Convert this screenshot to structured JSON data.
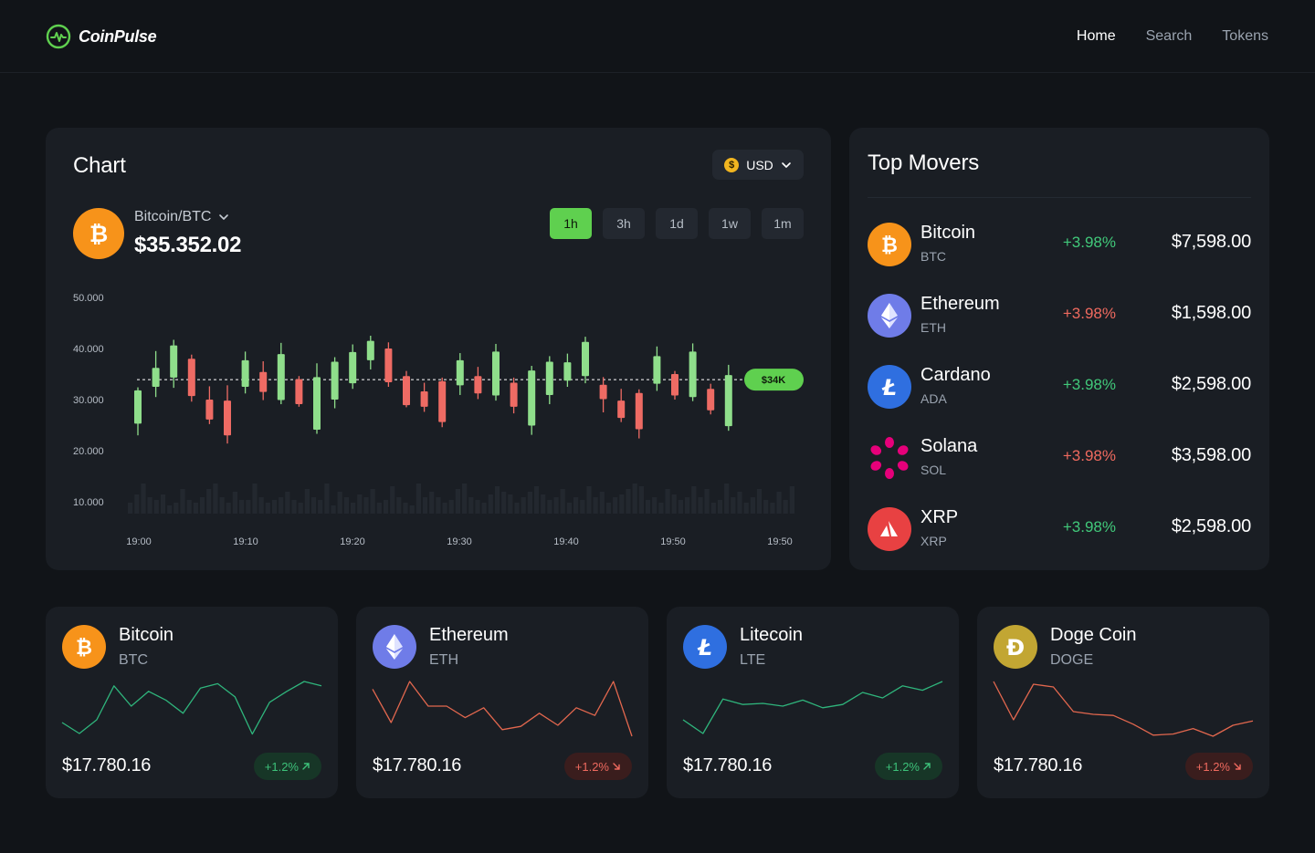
{
  "brand": {
    "name": "CoinPulse"
  },
  "nav": {
    "items": [
      "Home",
      "Search",
      "Tokens"
    ],
    "active": "Home"
  },
  "chart_card": {
    "title": "Chart",
    "currency": "USD",
    "pair": "Bitcoin/BTC",
    "price": "$35.352.02",
    "timeframes": [
      "1h",
      "3h",
      "1d",
      "1w",
      "1m"
    ],
    "active_timeframe": "1h"
  },
  "chart_data": {
    "type": "candlestick",
    "y_ticks": [
      "50.000",
      "40.000",
      "30.000",
      "20.000",
      "10.000"
    ],
    "x_ticks": [
      "19:00",
      "19:10",
      "19:20",
      "19:30",
      "19:40",
      "19:50",
      "19:50"
    ],
    "ylim": [
      10000,
      50000
    ],
    "current_price_label": "$34K",
    "current_price": 33900,
    "up_color": "#8fde8b",
    "down_color": "#ee6b64",
    "candles": [
      {
        "o": 25300,
        "c": 31800,
        "h": 32400,
        "l": 23000
      },
      {
        "o": 32500,
        "c": 36200,
        "h": 39500,
        "l": 30500
      },
      {
        "o": 34300,
        "c": 40600,
        "h": 41700,
        "l": 32300
      },
      {
        "o": 38000,
        "c": 30700,
        "h": 38800,
        "l": 29600
      },
      {
        "o": 30000,
        "c": 26100,
        "h": 32600,
        "l": 25200
      },
      {
        "o": 29800,
        "c": 23000,
        "h": 32800,
        "l": 21400
      },
      {
        "o": 32500,
        "c": 37700,
        "h": 39400,
        "l": 31200
      },
      {
        "o": 35400,
        "c": 31500,
        "h": 37500,
        "l": 29900
      },
      {
        "o": 29900,
        "c": 38900,
        "h": 41100,
        "l": 29100
      },
      {
        "o": 34000,
        "c": 29100,
        "h": 34600,
        "l": 28600
      },
      {
        "o": 24100,
        "c": 34400,
        "h": 37100,
        "l": 23300
      },
      {
        "o": 30000,
        "c": 37400,
        "h": 38300,
        "l": 28300
      },
      {
        "o": 33200,
        "c": 39300,
        "h": 40800,
        "l": 32100
      },
      {
        "o": 37700,
        "c": 41500,
        "h": 42500,
        "l": 35900
      },
      {
        "o": 40000,
        "c": 33400,
        "h": 41200,
        "l": 32500
      },
      {
        "o": 34600,
        "c": 28900,
        "h": 35600,
        "l": 28500
      },
      {
        "o": 31600,
        "c": 28600,
        "h": 33300,
        "l": 27600
      },
      {
        "o": 33600,
        "c": 25600,
        "h": 34300,
        "l": 24600
      },
      {
        "o": 32800,
        "c": 37700,
        "h": 39100,
        "l": 30900
      },
      {
        "o": 34600,
        "c": 31200,
        "h": 36400,
        "l": 30100
      },
      {
        "o": 30800,
        "c": 39400,
        "h": 40900,
        "l": 29800
      },
      {
        "o": 33300,
        "c": 28600,
        "h": 34300,
        "l": 27300
      },
      {
        "o": 24900,
        "c": 35700,
        "h": 36600,
        "l": 23100
      },
      {
        "o": 30900,
        "c": 37400,
        "h": 38500,
        "l": 29100
      },
      {
        "o": 33700,
        "c": 37300,
        "h": 39000,
        "l": 32500
      },
      {
        "o": 34600,
        "c": 41300,
        "h": 42300,
        "l": 33200
      },
      {
        "o": 32900,
        "c": 30100,
        "h": 34400,
        "l": 27500
      },
      {
        "o": 29800,
        "c": 26400,
        "h": 32100,
        "l": 25600
      },
      {
        "o": 31300,
        "c": 24200,
        "h": 32000,
        "l": 22400
      },
      {
        "o": 33100,
        "c": 38500,
        "h": 40400,
        "l": 31700
      },
      {
        "o": 35000,
        "c": 30800,
        "h": 35600,
        "l": 30000
      },
      {
        "o": 30500,
        "c": 39400,
        "h": 41000,
        "l": 29700
      },
      {
        "o": 32100,
        "c": 27900,
        "h": 33100,
        "l": 27100
      },
      {
        "o": 24800,
        "c": 34800,
        "h": 36800,
        "l": 23900
      }
    ],
    "volume": [
      4,
      7,
      11,
      6,
      5,
      7,
      3,
      4,
      9,
      5,
      4,
      6,
      9,
      11,
      6,
      4,
      8,
      5,
      5,
      11,
      6,
      4,
      5,
      6,
      8,
      5,
      4,
      9,
      6,
      5,
      11,
      3,
      8,
      6,
      4,
      7,
      6,
      9,
      4,
      5,
      10,
      6,
      4,
      3,
      11,
      6,
      8,
      6,
      4,
      5,
      9,
      11,
      6,
      5,
      4,
      7,
      10,
      8,
      7,
      4,
      6,
      8,
      10,
      7,
      5,
      6,
      9,
      4,
      6,
      5,
      10,
      6,
      8,
      4,
      6,
      7,
      9,
      11,
      10,
      5,
      6,
      4,
      9,
      7,
      5,
      6,
      10,
      6,
      9,
      4,
      5,
      11,
      6,
      8,
      4,
      6,
      9,
      5,
      4,
      8,
      5,
      10
    ]
  },
  "top_movers": {
    "title": "Top Movers",
    "items": [
      {
        "name": "Bitcoin",
        "symbol": "BTC",
        "change": "+3.98%",
        "dir": "up",
        "price": "$7,598.00",
        "icon": "bitcoin-icon"
      },
      {
        "name": "Ethereum",
        "symbol": "ETH",
        "change": "+3.98%",
        "dir": "down",
        "price": "$1,598.00",
        "icon": "ethereum-icon"
      },
      {
        "name": "Cardano",
        "symbol": "ADA",
        "change": "+3.98%",
        "dir": "up",
        "price": "$2,598.00",
        "icon": "litecoin-icon"
      },
      {
        "name": "Solana",
        "symbol": "SOL",
        "change": "+3.98%",
        "dir": "down",
        "price": "$3,598.00",
        "icon": "polkadot-icon"
      },
      {
        "name": "XRP",
        "symbol": "XRP",
        "change": "+3.98%",
        "dir": "up",
        "price": "$2,598.00",
        "icon": "avalanche-icon"
      }
    ]
  },
  "mini_cards": [
    {
      "name": "Bitcoin",
      "symbol": "BTC",
      "price": "$17.780.16",
      "change": "+1.2%",
      "dir": "up",
      "icon": "bitcoin-icon",
      "line_color": "#2fb57c",
      "spark": [
        0.25,
        0.05,
        0.3,
        0.92,
        0.55,
        0.82,
        0.66,
        0.42,
        0.88,
        0.96,
        0.72,
        0.04,
        0.62,
        0.82,
        1.0,
        0.92
      ]
    },
    {
      "name": "Ethereum",
      "symbol": "ETH",
      "price": "$17.780.16",
      "change": "+1.2%",
      "dir": "down",
      "icon": "ethereum-icon",
      "line_color": "#e2674e",
      "spark": [
        0.86,
        0.25,
        1.0,
        0.55,
        0.55,
        0.34,
        0.52,
        0.12,
        0.18,
        0.42,
        0.2,
        0.52,
        0.38,
        1.0,
        0.0
      ]
    },
    {
      "name": "Litecoin",
      "symbol": "LTE",
      "price": "$17.780.16",
      "change": "+1.2%",
      "dir": "up",
      "icon": "litecoin-icon",
      "line_color": "#2fb57c",
      "spark": [
        0.3,
        0.05,
        0.68,
        0.58,
        0.6,
        0.55,
        0.66,
        0.52,
        0.58,
        0.8,
        0.7,
        0.92,
        0.84,
        1.0
      ]
    },
    {
      "name": "Doge Coin",
      "symbol": "DOGE",
      "price": "$17.780.16",
      "change": "+1.2%",
      "dir": "down",
      "icon": "dogecoin-icon",
      "line_color": "#e2674e",
      "spark": [
        1.0,
        0.3,
        0.95,
        0.9,
        0.45,
        0.4,
        0.38,
        0.22,
        0.02,
        0.04,
        0.14,
        0.0,
        0.2,
        0.28
      ]
    }
  ]
}
